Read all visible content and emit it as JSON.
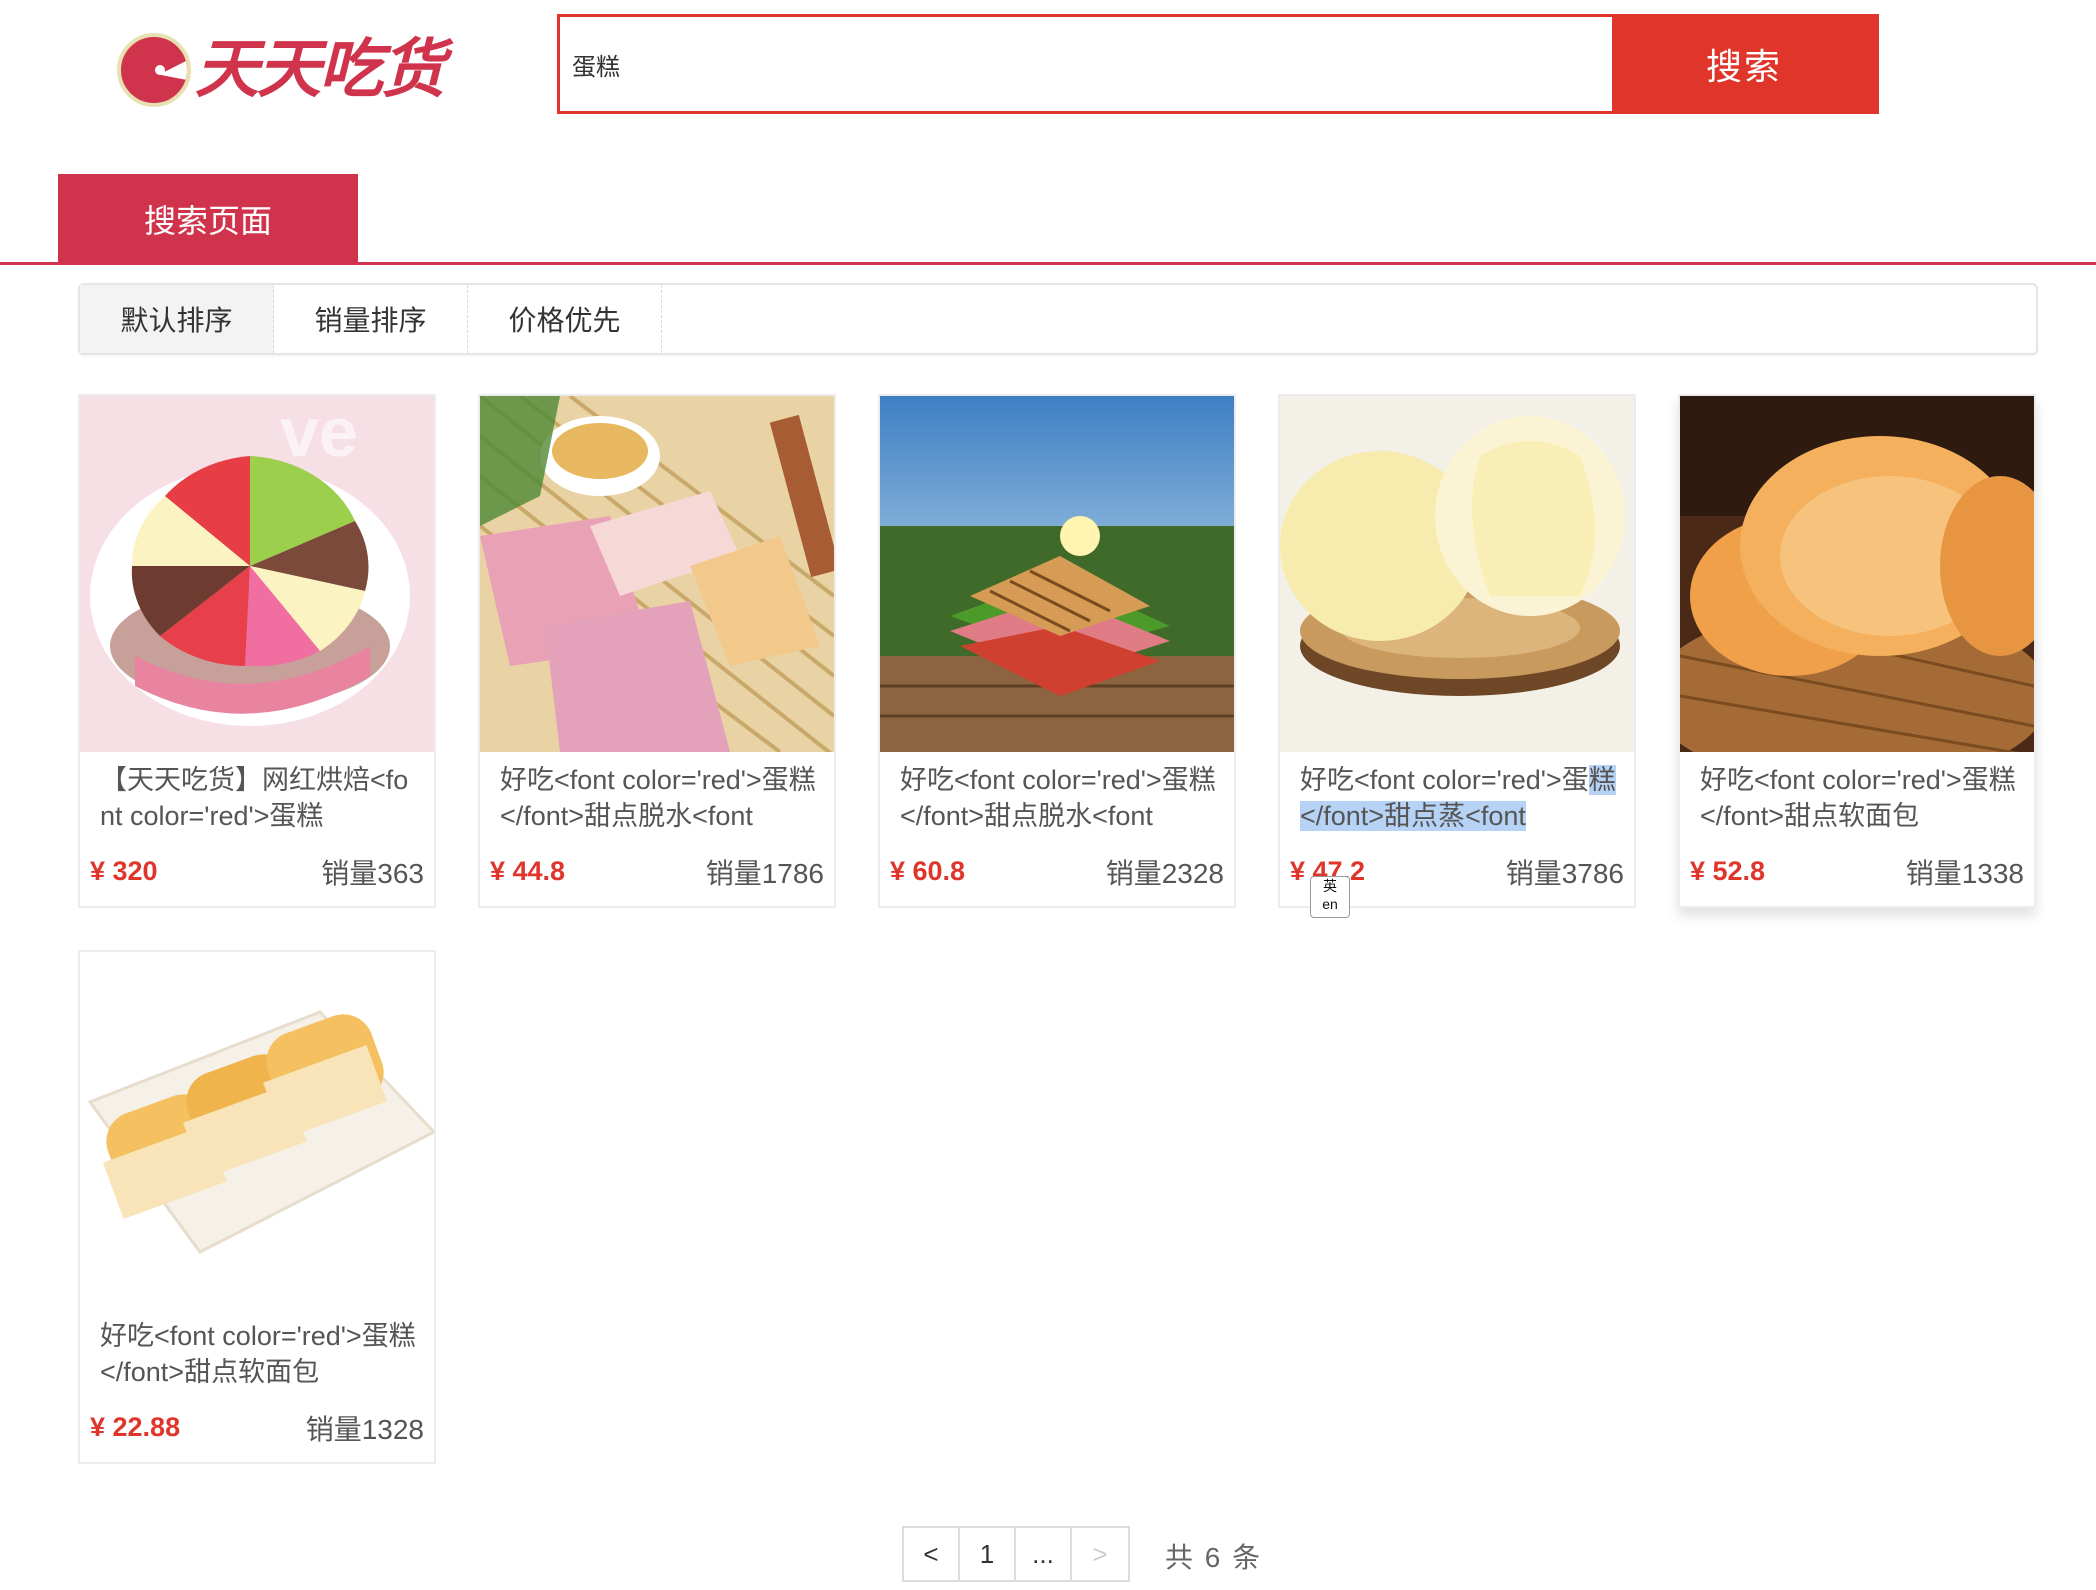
{
  "header": {
    "logo_text": "天天吃货",
    "search_value": "蛋糕",
    "search_button": "搜索"
  },
  "tab": {
    "label": "搜索页面"
  },
  "sort": [
    {
      "label": "默认排序",
      "active": true
    },
    {
      "label": "销量排序",
      "active": false
    },
    {
      "label": "价格优先",
      "active": false
    }
  ],
  "products": [
    {
      "title": "【天天吃货】网红烘焙<font color='red'>蛋糕",
      "price": "¥ 320",
      "sales": "销量363"
    },
    {
      "title": "好吃<font color='red'>蛋糕</font>甜点脱水<font",
      "price": "¥ 44.8",
      "sales": "销量1786"
    },
    {
      "title": "好吃<font color='red'>蛋糕</font>甜点脱水<font",
      "price": "¥ 60.8",
      "sales": "销量2328"
    },
    {
      "title_a": "好吃<font color='red'>蛋",
      "title_b": "糕</font>甜点蒸<font",
      "price": "¥ 47.2",
      "sales": "销量3786",
      "ime_top": "英",
      "ime_bottom": "en"
    },
    {
      "title": "好吃<font color='red'>蛋糕</font>甜点软面包",
      "price": "¥ 52.8",
      "sales": "销量1338"
    },
    {
      "title": "好吃<font color='red'>蛋糕</font>甜点软面包",
      "price": "¥ 22.88",
      "sales": "销量1328"
    }
  ],
  "pagination": {
    "prev": "<",
    "page": "1",
    "ellipsis": "...",
    "next": ">",
    "total": "共 6 条"
  },
  "colors": {
    "brand": "#d0344c",
    "search_accent": "#e0352b",
    "price": "#e0352b"
  }
}
